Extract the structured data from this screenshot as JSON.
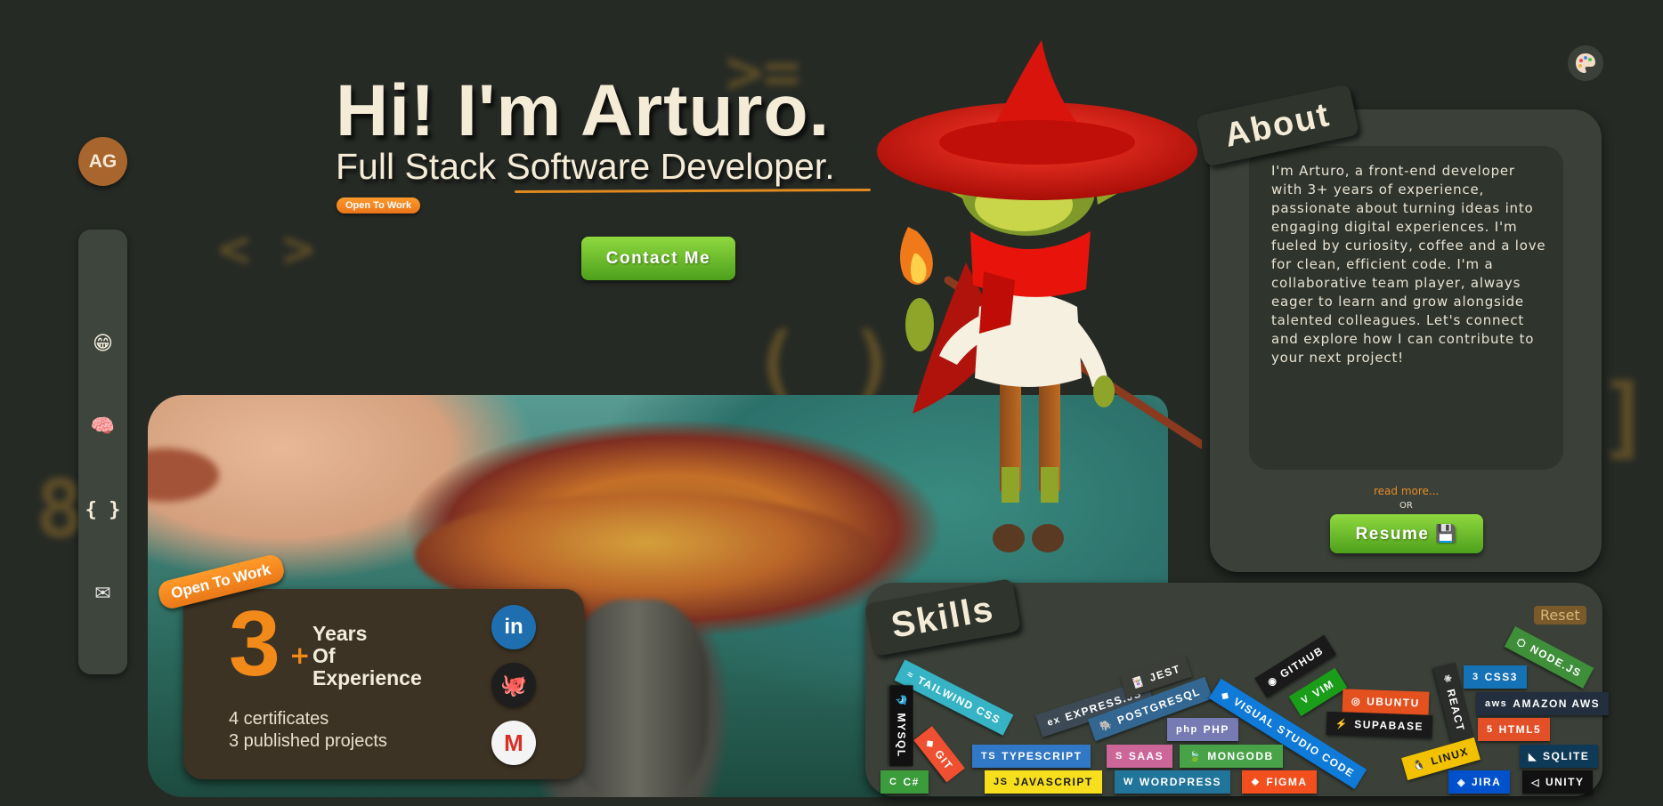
{
  "avatar": {
    "initials": "AG"
  },
  "nav": {
    "items": [
      {
        "name": "home",
        "icon": "smiley-icon",
        "glyph": "😁"
      },
      {
        "name": "about",
        "icon": "brain-icon",
        "glyph": "🧠"
      },
      {
        "name": "projects",
        "icon": "code-braces-icon",
        "glyph": "{ }"
      },
      {
        "name": "contact",
        "icon": "envelope-icon",
        "glyph": "✉"
      }
    ]
  },
  "hero": {
    "title": "Hi! I'm Arturo.",
    "subtitle": "Full Stack Software Developer.",
    "status_pill": "Open To Work",
    "contact_button": "Contact Me"
  },
  "stats": {
    "ribbon": "Open To Work",
    "years_number": "3",
    "plus": "+",
    "years_label_1": "Years",
    "years_label_2": "Of",
    "years_label_3": "Experience",
    "certificates": "4 certificates",
    "projects": "3 published projects",
    "socials": [
      {
        "name": "linkedin",
        "icon": "linkedin-icon",
        "glyph": "in"
      },
      {
        "name": "github",
        "icon": "github-icon",
        "glyph": "🐙"
      },
      {
        "name": "gmail",
        "icon": "gmail-icon",
        "glyph": "M"
      }
    ]
  },
  "about": {
    "tab": "About",
    "text": "I'm Arturo, a front-end developer with 3+ years of experience, passionate about turning ideas into engaging digital experiences. I'm fueled by curiosity, coffee and a love for clean, efficient code. I'm a collaborative team player, always eager to learn and grow alongside talented colleagues. Let's connect and explore how I can contribute to your next project!",
    "read_more": "read more...",
    "or": "OR",
    "resume_button": "Resume 💾"
  },
  "skills": {
    "tab": "Skills",
    "reset": "Reset",
    "chips": [
      {
        "label": "TAILWIND CSS",
        "icon": "tailwind-icon",
        "glyph": "≈",
        "color": "#36b3c4"
      },
      {
        "label": "EXPRESS.JS",
        "icon": "express-icon",
        "glyph": "ex",
        "color": "#3d4a55"
      },
      {
        "label": "JEST",
        "icon": "jest-icon",
        "glyph": "🃏",
        "color": "#3c3e3a"
      },
      {
        "label": "POSTGRESQL",
        "icon": "postgresql-icon",
        "glyph": "🐘",
        "color": "#336791"
      },
      {
        "label": "GITHUB",
        "icon": "github-icon",
        "glyph": "◉",
        "color": "#1a1a1a"
      },
      {
        "label": "VIM",
        "icon": "vim-icon",
        "glyph": "V",
        "color": "#1a9e1a"
      },
      {
        "label": "UBUNTU",
        "icon": "ubuntu-icon",
        "glyph": "◎",
        "color": "#e4511e"
      },
      {
        "label": "REACT",
        "icon": "react-icon",
        "glyph": "⚛",
        "color": "#2a2d2a"
      },
      {
        "label": "CSS3",
        "icon": "css3-icon",
        "glyph": "3",
        "color": "#1572b6"
      },
      {
        "label": "NODE.JS",
        "icon": "nodejs-icon",
        "glyph": "⬡",
        "color": "#3f8f3a"
      },
      {
        "label": "MYSQL",
        "icon": "mysql-icon",
        "glyph": "🐬",
        "color": "#111111"
      },
      {
        "label": "PHP",
        "icon": "php-icon",
        "glyph": "php",
        "color": "#777bb3"
      },
      {
        "label": "VISUAL STUDIO CODE",
        "icon": "vscode-icon",
        "glyph": "◆",
        "color": "#0f7ad8"
      },
      {
        "label": "SUPABASE",
        "icon": "supabase-icon",
        "glyph": "⚡",
        "color": "#1a1a1a"
      },
      {
        "label": "AMAZON AWS",
        "icon": "aws-icon",
        "glyph": "aws",
        "color": "#232f3e"
      },
      {
        "label": "HTML5",
        "icon": "html5-icon",
        "glyph": "5",
        "color": "#e34f26"
      },
      {
        "label": "GIT",
        "icon": "git-icon",
        "glyph": "◆",
        "color": "#f05032"
      },
      {
        "label": "TYPESCRIPT",
        "icon": "typescript-icon",
        "glyph": "TS",
        "color": "#3178c6"
      },
      {
        "label": "SAAS",
        "icon": "sass-icon",
        "glyph": "S",
        "color": "#cc6699"
      },
      {
        "label": "MONGODB",
        "icon": "mongodb-icon",
        "glyph": "🍃",
        "color": "#47a248"
      },
      {
        "label": "LINUX",
        "icon": "linux-icon",
        "glyph": "🐧",
        "color": "#f2c200"
      },
      {
        "label": "SQLITE",
        "icon": "sqlite-icon",
        "glyph": "◣",
        "color": "#0f3a57"
      },
      {
        "label": "C#",
        "icon": "csharp-icon",
        "glyph": "C",
        "color": "#3a9c3a"
      },
      {
        "label": "JAVASCRIPT",
        "icon": "javascript-icon",
        "glyph": "JS",
        "color": "#f7df1e"
      },
      {
        "label": "WORDPRESS",
        "icon": "wordpress-icon",
        "glyph": "W",
        "color": "#21759b"
      },
      {
        "label": "FIGMA",
        "icon": "figma-icon",
        "glyph": "❖",
        "color": "#f24e1e"
      },
      {
        "label": "JIRA",
        "icon": "jira-icon",
        "glyph": "◈",
        "color": "#0052cc"
      },
      {
        "label": "UNITY",
        "icon": "unity-icon",
        "glyph": "◁",
        "color": "#111111"
      }
    ]
  },
  "colors": {
    "background": "#262a25",
    "card": "#3b4139",
    "accent_orange": "#f28a1a",
    "accent_green": "#5cb52a"
  }
}
